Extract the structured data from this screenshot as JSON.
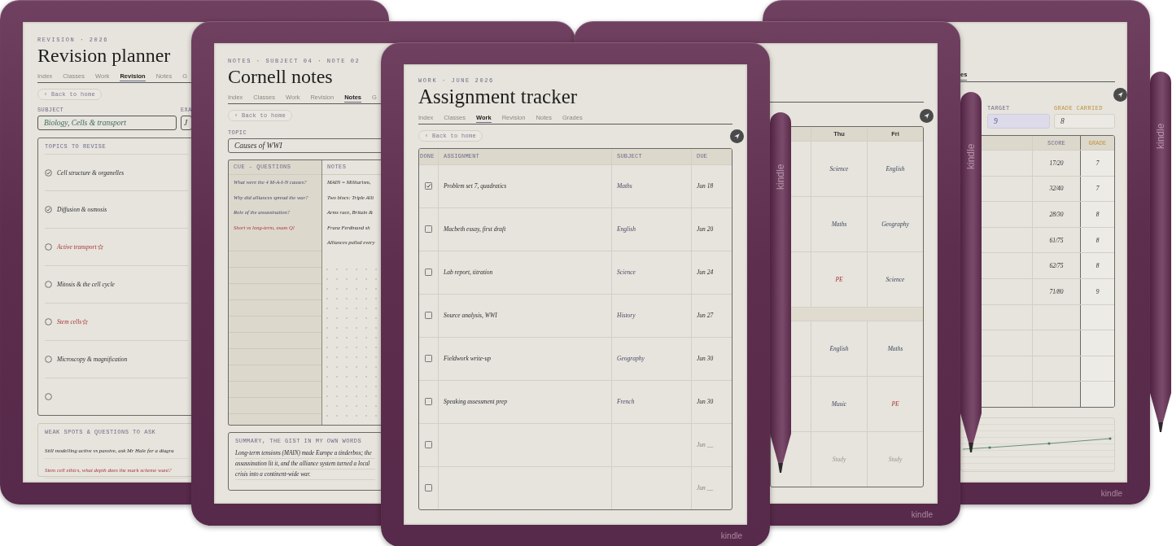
{
  "revision_planner": {
    "kicker": "REVISION · 2026",
    "title": "Revision planner",
    "tabs": [
      {
        "label": "Index",
        "selected": false
      },
      {
        "label": "Classes",
        "selected": false
      },
      {
        "label": "Work",
        "selected": false
      },
      {
        "label": "Revision",
        "selected": true
      },
      {
        "label": "Notes",
        "selected": false
      },
      {
        "label": "G",
        "selected": false
      }
    ],
    "back_link": "‹ Back to home",
    "fields": [
      {
        "label": "SUBJECT",
        "value": "Biology, Cells & transport"
      },
      {
        "label": "EXA",
        "value": "J"
      }
    ],
    "topics": {
      "heading": "TOPICS TO REVISE",
      "items": [
        {
          "text": "Cell structure & organelles",
          "checked": true,
          "flagged": false
        },
        {
          "text": "Diffusion & osmosis",
          "checked": true,
          "flagged": false
        },
        {
          "text": "Active transport",
          "checked": false,
          "flagged": true
        },
        {
          "text": "Mitosis & the cell cycle",
          "checked": false,
          "flagged": false
        },
        {
          "text": "Stem cells",
          "checked": false,
          "flagged": true
        },
        {
          "text": "Microscopy & magnification",
          "checked": false,
          "flagged": false
        },
        {
          "checked": false
        }
      ]
    },
    "weak_spots": {
      "heading": "WEAK SPOTS & QUESTIONS TO ASK",
      "lines": [
        {
          "text": "Still modelling active vs passive, ask Mr Hale for a diagra",
          "flagged": false
        },
        {
          "text": "Stem cell ethics, what depth does the mark scheme want?",
          "flagged": true
        }
      ]
    }
  },
  "cornell_notes": {
    "kicker": "NOTES · SUBJECT 04 · NOTE 02",
    "title": "Cornell notes",
    "tabs": [
      {
        "label": "Index",
        "selected": false
      },
      {
        "label": "Classes",
        "selected": false
      },
      {
        "label": "Work",
        "selected": false
      },
      {
        "label": "Revision",
        "selected": false
      },
      {
        "label": "Notes",
        "selected": true
      },
      {
        "label": "G",
        "selected": false
      }
    ],
    "back_link": "‹ Back to home",
    "topic": {
      "label": "TOPIC",
      "value": "Causes of WWI"
    },
    "columns": [
      "CUE - QUESTIONS",
      "NOTES"
    ],
    "cues": [
      {
        "text": "What were the 4 M-A-I-N causes?",
        "flagged": false
      },
      {
        "text": "Why did alliances spread the war?",
        "flagged": false
      },
      {
        "text": "Role of the assassination?",
        "flagged": false
      },
      {
        "text": "Short vs long-term, exam Q!",
        "flagged": true
      }
    ],
    "notes": [
      "MAIN = Militarism,",
      "Two blocs: Triple Alli",
      "Arms race, Britain &",
      "Franz Ferdinand sh",
      "Alliances pulled every"
    ],
    "summary": {
      "heading": "SUMMARY, THE GIST IN MY OWN WORDS",
      "text": "Long-term tensions (MAIN) made Europe a tinderbox; the assassination lit it, and the alliance system turned a local crisis into a continent-wide war."
    }
  },
  "timetable": {
    "columns": [
      "Thu",
      "Fri"
    ],
    "rows": [
      {
        "kind": "lesson",
        "cells": [
          {
            "text": "Science",
            "flagged": false,
            "muted": false
          },
          {
            "text": "English",
            "flagged": false,
            "muted": false
          }
        ]
      },
      {
        "kind": "lesson",
        "cells": [
          {
            "text": "Maths",
            "flagged": false,
            "muted": false
          },
          {
            "text": "Geography",
            "flagged": false,
            "muted": false
          }
        ]
      },
      {
        "kind": "lesson",
        "cells": [
          {
            "text": "PE",
            "flagged": true,
            "muted": false
          },
          {
            "text": "Science",
            "flagged": false,
            "muted": false
          }
        ]
      },
      {
        "kind": "break"
      },
      {
        "kind": "lesson",
        "cells": [
          {
            "text": "English",
            "flagged": false,
            "muted": false
          },
          {
            "text": "Maths",
            "flagged": false,
            "muted": false
          }
        ]
      },
      {
        "kind": "lesson",
        "cells": [
          {
            "text": "Music",
            "flagged": false,
            "muted": false
          },
          {
            "text": "PE",
            "flagged": true,
            "muted": false
          }
        ]
      },
      {
        "kind": "lesson",
        "cells": [
          {
            "text": "Study",
            "flagged": false,
            "muted": true
          },
          {
            "text": "Study",
            "flagged": false,
            "muted": true
          }
        ]
      }
    ],
    "logo": "kindle"
  },
  "grades": {
    "tab": {
      "label": "es",
      "selected": true
    },
    "fields": [
      {
        "kind": "target",
        "label": "TARGET",
        "value": "9"
      },
      {
        "kind": "carried",
        "label": "GRADE CARRIED",
        "value": "8"
      }
    ],
    "columns": [
      "SCORE",
      "GRADE"
    ],
    "rows": [
      {
        "score": "17/20",
        "grade": "7"
      },
      {
        "score": "32/40",
        "grade": "7"
      },
      {
        "score": "28/30",
        "grade": "8"
      },
      {
        "score": "61/75",
        "grade": "8"
      },
      {
        "score": "62/75",
        "grade": "8"
      },
      {
        "score": "71/80",
        "grade": "9"
      }
    ],
    "logo": "kindle"
  },
  "assignment_tracker": {
    "kicker": "WORK · JUNE 2026",
    "title": "Assignment tracker",
    "tabs": [
      {
        "label": "Index",
        "selected": false
      },
      {
        "label": "Classes",
        "selected": false
      },
      {
        "label": "Work",
        "selected": true
      },
      {
        "label": "Revision",
        "selected": false
      },
      {
        "label": "Notes",
        "selected": false
      },
      {
        "label": "Grades",
        "selected": false
      }
    ],
    "back_link": "‹ Back to home",
    "columns": [
      "DONE",
      "ASSIGNMENT",
      "SUBJECT",
      "DUE"
    ],
    "rows": [
      {
        "checked": true,
        "assignment": "Problem set 7, quadratics",
        "subject": "Maths",
        "due": "Jun 18"
      },
      {
        "checked": false,
        "assignment": "Macbeth essay, first draft",
        "subject": "English",
        "due": "Jun 20"
      },
      {
        "checked": false,
        "assignment": "Lab report, titration",
        "subject": "Science",
        "due": "Jun 24"
      },
      {
        "checked": false,
        "assignment": "Source analysis, WWI",
        "subject": "History",
        "due": "Jun 27"
      },
      {
        "checked": false,
        "assignment": "Fieldwork write-up",
        "subject": "Geography",
        "due": "Jun 30"
      },
      {
        "checked": false,
        "assignment": "Speaking assessment prep",
        "subject": "French",
        "due": "Jun 30"
      },
      {
        "checked": false,
        "placeholder": "Jun __"
      },
      {
        "checked": false,
        "placeholder": "Jun __"
      }
    ],
    "logo": "kindle"
  },
  "pens": [
    {
      "logo": "kindle"
    },
    {
      "logo": "kindle"
    },
    {
      "logo": "kindle"
    }
  ]
}
